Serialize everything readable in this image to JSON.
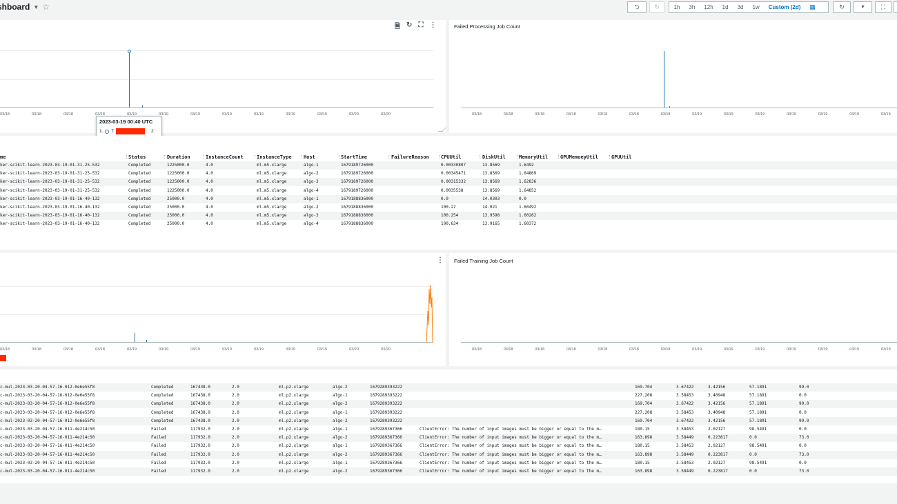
{
  "header": {
    "title": "shboard",
    "undo_icon": "undo-icon",
    "redo_icon": "redo-icon",
    "ranges": [
      "1h",
      "3h",
      "12h",
      "1d",
      "3d",
      "1w"
    ],
    "custom_range": "Custom (2d)",
    "refresh_icon": "refresh-icon",
    "dropdown_icon": "caret-down-icon",
    "expand_icon": "expand-icon"
  },
  "panel1": {
    "ticks": [
      "03/18",
      "03/18",
      "03/18",
      "03/18",
      "03/19",
      "03/19",
      "03/19",
      "03/19",
      "03/19",
      "03/19",
      "03/19",
      "03/20",
      "03/20"
    ],
    "tooltip": {
      "time": "2023-03-19 00:40 UTC",
      "row_index": "1.",
      "row_prefix": "7",
      "row_value": "2"
    }
  },
  "panel2": {
    "title": "Failed Processing Job Count",
    "ticks": [
      "03/18",
      "03/18",
      "03/18",
      "03/18",
      "03/18",
      "03/18",
      "03/18",
      "03/19",
      "03/19",
      "03/19",
      "03/19",
      "03/19",
      "03/19",
      "03/19"
    ]
  },
  "table1": {
    "headers": [
      "me",
      "Status",
      "Duration",
      "InstanceCount",
      "InstanceType",
      "Host",
      "StartTime",
      "FailureReason",
      "CPUUtil",
      "DiskUtil",
      "MemoryUtil",
      "GPUMemoeyUtil",
      "GPUUtil"
    ],
    "rows": [
      [
        "ker-scikit-learn-2023-03-19-01-31-25-532",
        "Completed",
        "1225000.0",
        "4.0",
        "ml.m5.xlarge",
        "algo-1",
        "1679189726000",
        "",
        "0.00330807",
        "13.8569",
        "1.6492"
      ],
      [
        "ker-scikit-learn-2023-03-19-01-31-25-532",
        "Completed",
        "1225000.0",
        "4.0",
        "ml.m5.xlarge",
        "algo-2",
        "1679189726000",
        "",
        "0.00345471",
        "13.8569",
        "1.64869"
      ],
      [
        "ker-scikit-learn-2023-03-19-01-31-25-532",
        "Completed",
        "1225000.0",
        "4.0",
        "ml.m5.xlarge",
        "algo-3",
        "1679189726000",
        "",
        "0.00315332",
        "13.8569",
        "1.62836"
      ],
      [
        "ker-scikit-learn-2023-03-19-01-31-25-532",
        "Completed",
        "1225000.0",
        "4.0",
        "ml.m5.xlarge",
        "algo-4",
        "1679189726000",
        "",
        "0.0035538",
        "13.8569",
        "1.64852"
      ],
      [
        "ker-scikit-learn-2023-03-19-01-16-40-132",
        "Completed",
        "25000.0",
        "4.0",
        "ml.m5.xlarge",
        "algo-1",
        "1679188836000",
        "",
        "0.0",
        "14.0303",
        "0.0"
      ],
      [
        "ker-scikit-learn-2023-03-19-01-16-40-132",
        "Completed",
        "25000.0",
        "4.0",
        "ml.m5.xlarge",
        "algo-2",
        "1679188836000",
        "",
        "100.27",
        "14.021",
        "1.60492"
      ],
      [
        "ker-scikit-learn-2023-03-19-01-16-40-132",
        "Completed",
        "25000.0",
        "4.0",
        "ml.m5.xlarge",
        "algo-3",
        "1679188836000",
        "",
        "100.254",
        "13.9598",
        "1.60262"
      ],
      [
        "ker-scikit-learn-2023-03-19-01-16-40-132",
        "Completed",
        "25000.0",
        "4.0",
        "ml.m5.xlarge",
        "algo-4",
        "1679188836000",
        "",
        "100.634",
        "13.9165",
        "1.60372"
      ]
    ]
  },
  "panel3": {
    "ticks": [
      "03/18",
      "03/18",
      "03/18",
      "03/18",
      "03/19",
      "03/19",
      "03/19",
      "03/19",
      "03/19",
      "03/19",
      "03/19",
      "03/20",
      "03/20"
    ]
  },
  "panel4": {
    "title": "Failed Training Job Count",
    "ticks": [
      "03/18",
      "03/18",
      "03/18",
      "03/18",
      "03/18",
      "03/18",
      "03/18",
      "03/19",
      "03/19",
      "03/19",
      "03/19",
      "03/19",
      "03/19",
      "03/19"
    ]
  },
  "table2": {
    "rows": [
      [
        "c-mul-2023-03-20-04-57-16-012-0e6e55f8",
        "Completed",
        "167438.0",
        "2.0",
        "ml.p2.xlarge",
        "algo-2",
        "1679289393222",
        "",
        "169.704",
        "3.67422",
        "3.42156",
        "57.1891",
        "99.0"
      ],
      [
        "c-mul-2023-03-20-04-57-16-012-0e6e55f8",
        "Completed",
        "167438.0",
        "2.0",
        "ml.p2.xlarge",
        "algo-1",
        "1679289393222",
        "",
        "227.208",
        "3.58453",
        "3.40948",
        "57.1891",
        "0.0"
      ],
      [
        "c-mul-2023-03-20-04-57-16-012-0e6e55f8",
        "Completed",
        "167438.0",
        "2.0",
        "ml.p2.xlarge",
        "algo-2",
        "1679289393222",
        "",
        "169.704",
        "3.67422",
        "3.42156",
        "57.1891",
        "99.0"
      ],
      [
        "c-mul-2023-03-20-04-57-16-012-0e6e55f8",
        "Completed",
        "167438.0",
        "2.0",
        "ml.p2.xlarge",
        "algo-1",
        "1679289393222",
        "",
        "227.208",
        "3.58453",
        "3.40948",
        "57.1891",
        "0.0"
      ],
      [
        "c-mul-2023-03-20-04-57-16-012-0e6e55f8",
        "Completed",
        "167438.0",
        "2.0",
        "ml.p2.xlarge",
        "algo-2",
        "1679289393222",
        "",
        "169.704",
        "3.67422",
        "3.42156",
        "57.1891",
        "99.0"
      ],
      [
        "c-mul-2023-03-20-04-57-16-011-4e214c50",
        "Failed",
        "117932.0",
        "2.0",
        "ml.p2.xlarge",
        "algo-1",
        "1679289367366",
        "ClientError: The number of input images must be bigger or equal to the m…",
        "180.15",
        "3.58453",
        "2.02127",
        "98.5491",
        "0.0"
      ],
      [
        "c-mul-2023-03-20-04-57-16-011-4e214c50",
        "Failed",
        "117932.0",
        "2.0",
        "ml.p2.xlarge",
        "algo-2",
        "1679289367366",
        "ClientError: The number of input images must be bigger or equal to the m…",
        "163.898",
        "3.58449",
        "0.223817",
        "0.0",
        "73.0"
      ],
      [
        "c-mul-2023-03-20-04-57-16-011-4e214c50",
        "Failed",
        "117932.0",
        "2.0",
        "ml.p2.xlarge",
        "algo-1",
        "1679289367366",
        "ClientError: The number of input images must be bigger or equal to the m…",
        "180.15",
        "3.58453",
        "2.02127",
        "98.5491",
        "0.0"
      ],
      [
        "c-mul-2023-03-20-04-57-16-011-4e214c50",
        "Failed",
        "117932.0",
        "2.0",
        "ml.p2.xlarge",
        "algo-2",
        "1679289367366",
        "ClientError: The number of input images must be bigger or equal to the m…",
        "163.898",
        "3.58449",
        "0.223817",
        "0.0",
        "73.0"
      ],
      [
        "c-mul-2023-03-20-04-57-16-011-4e214c50",
        "Failed",
        "117932.0",
        "2.0",
        "ml.p2.xlarge",
        "algo-1",
        "1679289367366",
        "ClientError: The number of input images must be bigger or equal to the m…",
        "180.15",
        "3.58453",
        "2.02127",
        "98.5491",
        "0.0"
      ],
      [
        "c-mul-2023-03-20-04-57-16-011-4e214c50",
        "Failed",
        "117932.0",
        "2.0",
        "ml.p2.xlarge",
        "algo-2",
        "1679289367366",
        "ClientError: The number of input images must be bigger or equal to the m…",
        "163.898",
        "3.58449",
        "0.223817",
        "0.0",
        "73.0"
      ]
    ]
  }
}
